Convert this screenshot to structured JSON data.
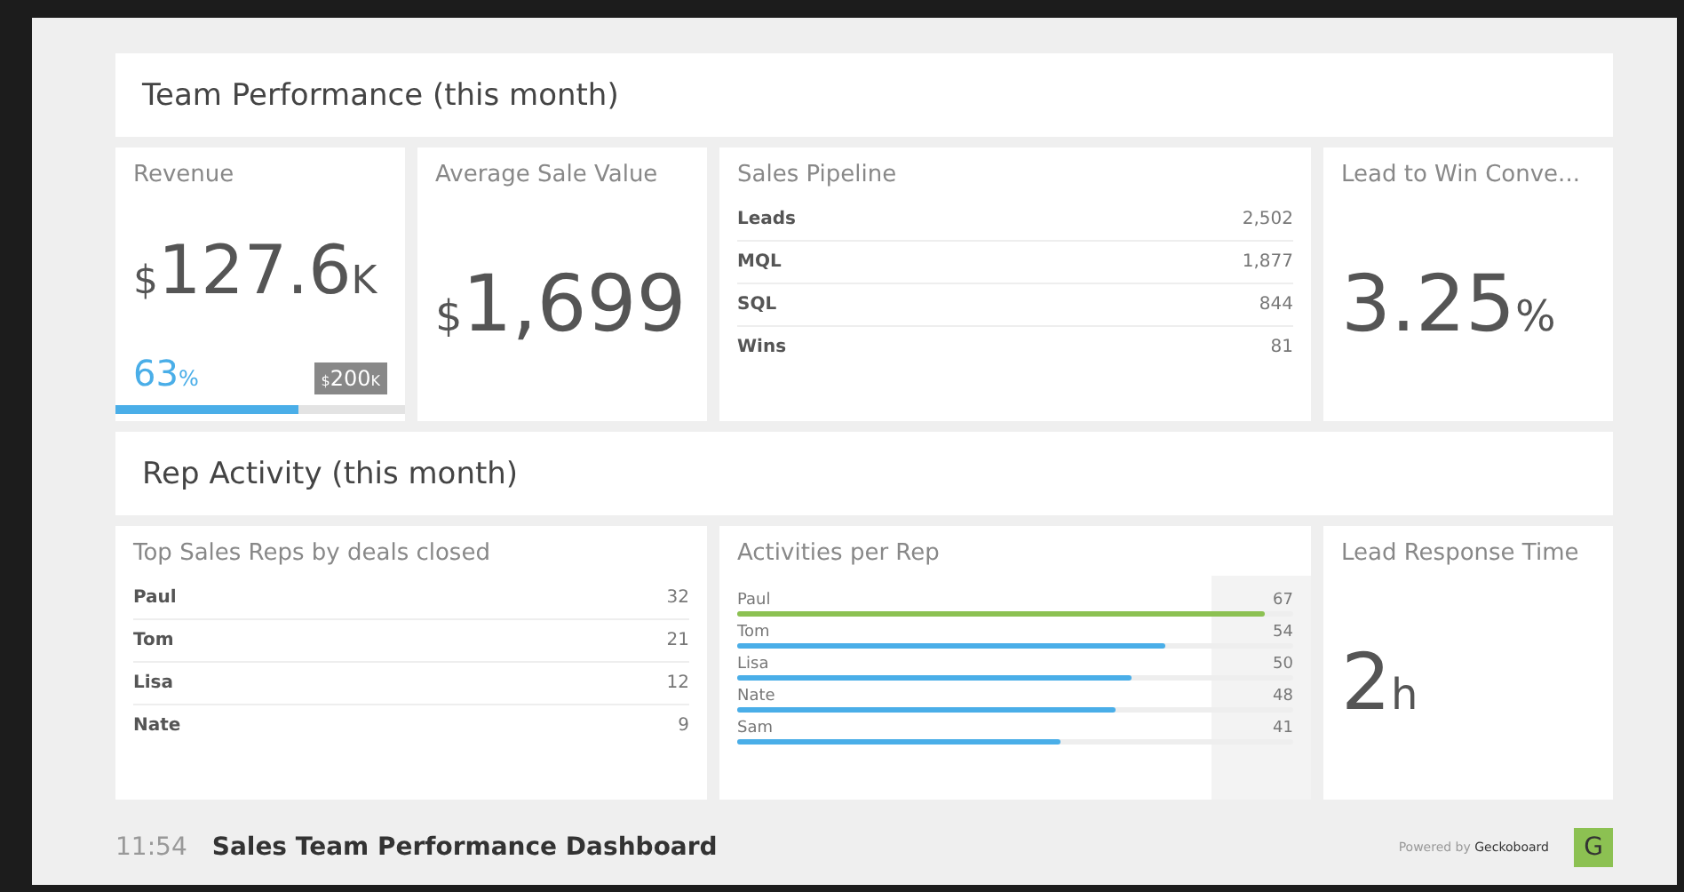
{
  "sections": [
    {
      "title": "Team Performance (this month)",
      "widgets": [
        {
          "kind": "goal",
          "title": "Revenue",
          "prefix": "$",
          "value": "127.6",
          "suffix": "K",
          "percent": "63",
          "percent_unit": "%",
          "goal_prefix": "$",
          "goal": "200",
          "goal_suffix": "K",
          "level": 0.63
        },
        {
          "kind": "number",
          "title": "Average Sale Value",
          "prefix": "$",
          "value": "1,699"
        },
        {
          "kind": "list",
          "title": "Sales Pipeline",
          "rows": [
            {
              "label": "Leads",
              "value": "2,502"
            },
            {
              "label": "MQL",
              "value": "1,877"
            },
            {
              "label": "SQL",
              "value": "844"
            },
            {
              "label": "Wins",
              "value": "81"
            }
          ]
        },
        {
          "kind": "number",
          "title": "Lead to Win Conve...",
          "value": "3.25",
          "suffix": "%"
        }
      ]
    },
    {
      "title": "Rep Activity (this month)",
      "widgets": [
        {
          "kind": "list",
          "title": "Top Sales Reps by deals closed",
          "rows": [
            {
              "label": "Paul",
              "value": "32"
            },
            {
              "label": "Tom",
              "value": "21"
            },
            {
              "label": "Lisa",
              "value": "12"
            },
            {
              "label": "Nate",
              "value": "9"
            }
          ]
        },
        {
          "kind": "bars",
          "title": "Activities per Rep",
          "rows": [
            {
              "label": "Paul",
              "value": "67",
              "level": 0.95,
              "color": "#8cc152"
            },
            {
              "label": "Tom",
              "value": "54",
              "level": 0.77,
              "color": "#4aaee8"
            },
            {
              "label": "Lisa",
              "value": "50",
              "level": 0.71,
              "color": "#4aaee8"
            },
            {
              "label": "Nate",
              "value": "48",
              "level": 0.68,
              "color": "#4aaee8"
            },
            {
              "label": "Sam",
              "value": "41",
              "level": 0.58,
              "color": "#4aaee8"
            }
          ]
        },
        {
          "kind": "number",
          "title": "Lead Response Time",
          "value": "2",
          "suffix": "h"
        }
      ]
    }
  ],
  "footer": {
    "time": "11:54",
    "title": "Sales Team Performance Dashboard",
    "powered": "Powered by **Geckoboard**",
    "logo": "G"
  }
}
